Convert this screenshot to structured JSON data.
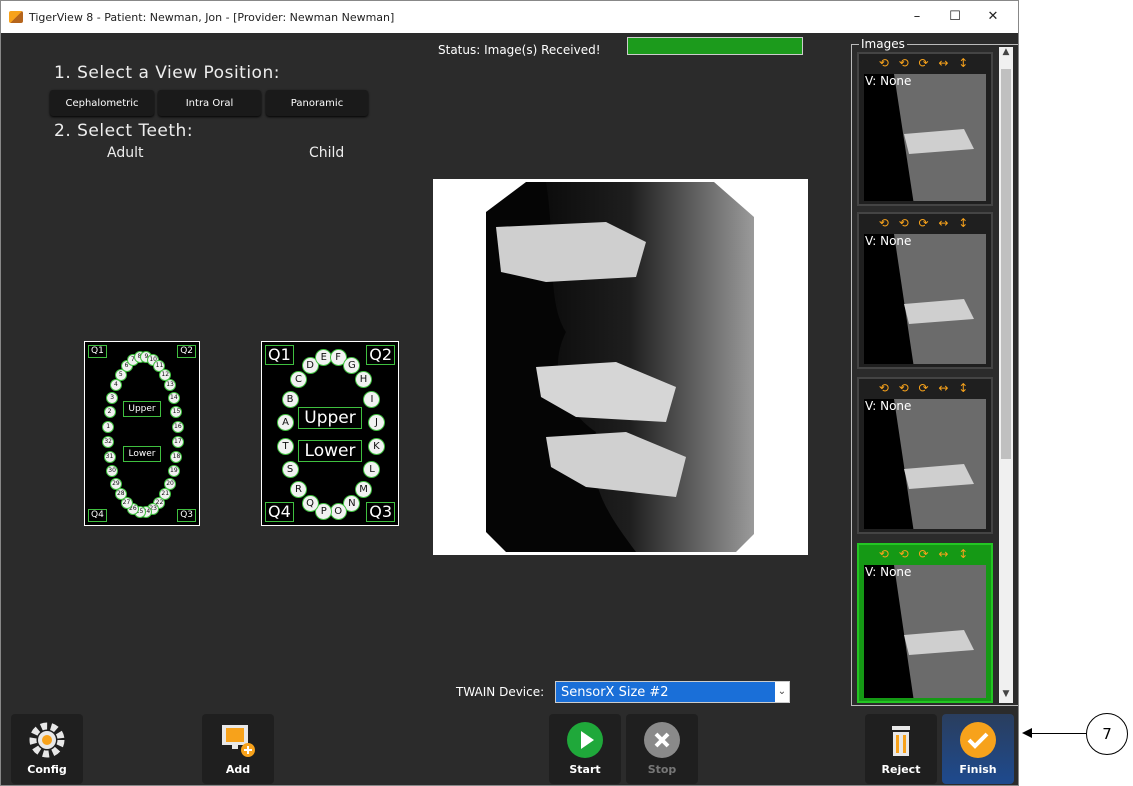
{
  "window": {
    "title": "TigerView 8 - Patient: Newman, Jon - [Provider: Newman Newman]",
    "min": "–",
    "max": "☐",
    "close": "✕"
  },
  "step1": {
    "title": "1. Select a View Position:",
    "buttons": [
      "Cephalometric",
      "Intra Oral",
      "Panoramic"
    ]
  },
  "step2": {
    "title": "2. Select Teeth:",
    "adult_label": "Adult",
    "child_label": "Child"
  },
  "adult_chart": {
    "quadrants": [
      "Q1",
      "Q2",
      "Q4",
      "Q3"
    ],
    "upper": "Upper",
    "lower": "Lower",
    "upper_teeth": [
      "1",
      "2",
      "3",
      "4",
      "5",
      "6",
      "7",
      "8",
      "9",
      "10",
      "11",
      "12",
      "13",
      "14",
      "15",
      "16"
    ],
    "lower_teeth": [
      "17",
      "18",
      "19",
      "20",
      "21",
      "22",
      "23",
      "24",
      "25",
      "26",
      "27",
      "28",
      "29",
      "30",
      "31",
      "32"
    ]
  },
  "child_chart": {
    "quadrants": [
      "Q1",
      "Q2",
      "Q4",
      "Q3"
    ],
    "upper": "Upper",
    "lower": "Lower",
    "upper_teeth": [
      "A",
      "B",
      "C",
      "D",
      "E",
      "F",
      "G",
      "H",
      "I",
      "J"
    ],
    "lower_teeth": [
      "K",
      "L",
      "M",
      "N",
      "O",
      "P",
      "Q",
      "R",
      "S",
      "T"
    ]
  },
  "status": {
    "text": "Status: Image(s) Received!",
    "color": "#1c9b1c"
  },
  "twain": {
    "label": "TWAIN Device:",
    "value": "SensorX Size #2"
  },
  "images": {
    "title": "Images",
    "thumbs": [
      {
        "view": "V: None",
        "tools": "⟲ ⟲ ⟳ ↔ ↕"
      },
      {
        "view": "V: None",
        "tools": "⟲ ⟲ ⟳ ↔ ↕"
      },
      {
        "view": "V: None",
        "tools": "⟲ ⟲ ⟳ ↔ ↕"
      },
      {
        "view": "V: None",
        "tools": "⟲ ⟲ ⟳ ↔ ↕",
        "selected": true
      }
    ]
  },
  "bottom": {
    "config": "Config",
    "add": "Add",
    "start": "Start",
    "stop": "Stop",
    "reject": "Reject",
    "finish": "Finish"
  },
  "callout": "7"
}
